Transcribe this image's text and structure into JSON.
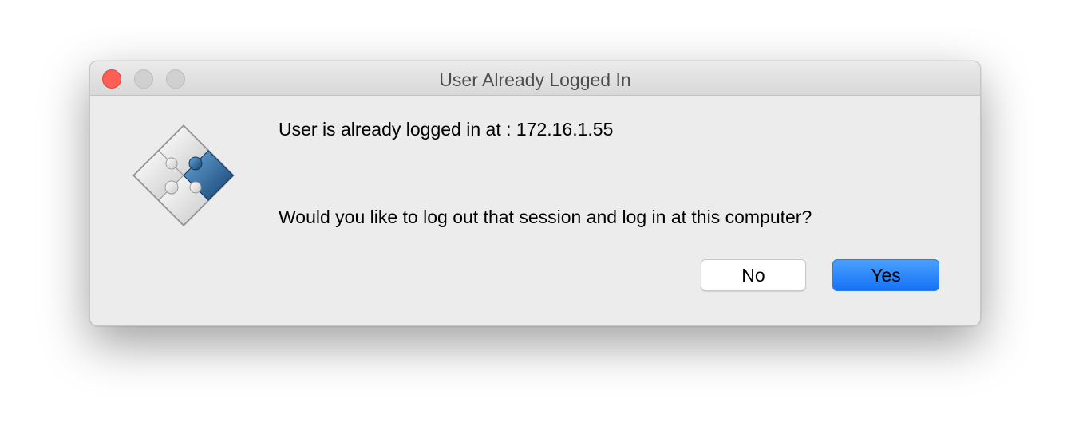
{
  "window": {
    "title": "User Already Logged In"
  },
  "dialog": {
    "icon": "puzzle-diamond-icon",
    "message_line1": "User is already logged in at : 172.16.1.55",
    "message_line2": "Would you like to log out that session and log in at this computer?",
    "buttons": {
      "no_label": "No",
      "yes_label": "Yes"
    }
  },
  "colors": {
    "close_button": "#fe5f57",
    "default_button": "#1672f5",
    "puzzle_accent": "#1d5a92"
  }
}
